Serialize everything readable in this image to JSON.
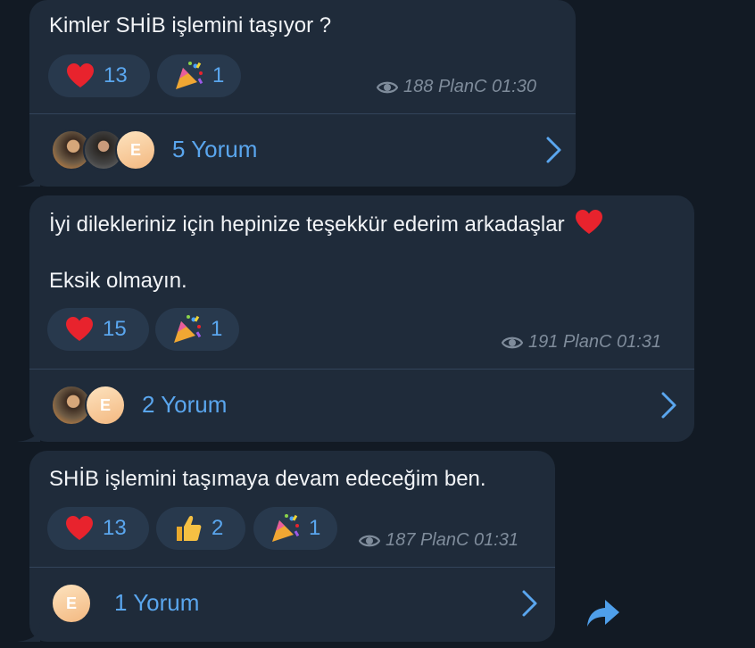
{
  "messages": [
    {
      "lines": [
        "Kimler SHİB işlemini taşıyor ?"
      ],
      "reactions": [
        {
          "emoji": "heart-icon",
          "count": "13"
        },
        {
          "emoji": "party-popper-icon",
          "count": "1"
        }
      ],
      "views": "188",
      "author": "PlanC",
      "time": "01:30",
      "comments_label": "5 Yorum",
      "avatars": [
        "photo",
        "photo",
        "E"
      ]
    },
    {
      "lines": [
        "İyi dilekleriniz için hepinize teşekkür ederim arkadaşlar",
        "Eksik olmayın."
      ],
      "inline_emoji": "heart-icon",
      "reactions": [
        {
          "emoji": "heart-icon",
          "count": "15"
        },
        {
          "emoji": "party-popper-icon",
          "count": "1"
        }
      ],
      "views": "191",
      "author": "PlanC",
      "time": "01:31",
      "comments_label": "2 Yorum",
      "avatars": [
        "photo",
        "E"
      ]
    },
    {
      "lines": [
        "SHİB işlemini taşımaya devam edeceğim ben."
      ],
      "reactions": [
        {
          "emoji": "heart-icon",
          "count": "13"
        },
        {
          "emoji": "thumbs-up-icon",
          "count": "2"
        },
        {
          "emoji": "party-popper-icon",
          "count": "1"
        }
      ],
      "views": "187",
      "author": "PlanC",
      "time": "01:31",
      "comments_label": "1 Yorum",
      "avatars": [
        "E"
      ]
    }
  ],
  "colors": {
    "background": "#121a24",
    "bubble": "#1f2b3a",
    "reaction_pill": "#28394d",
    "accent": "#5aa6ee",
    "meta": "#7f8c9b"
  }
}
